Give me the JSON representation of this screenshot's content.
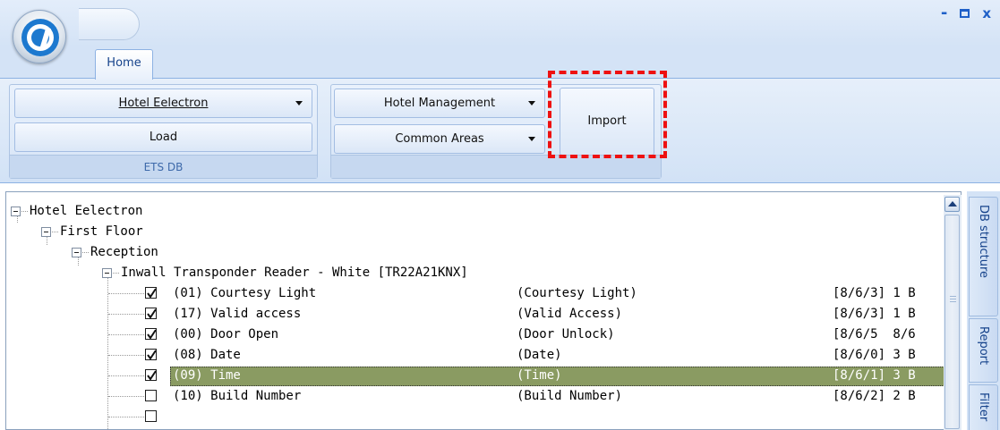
{
  "window": {
    "controls": {
      "minimize": "-",
      "maximize": "□",
      "close": "x"
    }
  },
  "ribbon": {
    "tabs": [
      "Home"
    ],
    "groups": {
      "ets_db": {
        "label": "ETS DB",
        "hotel_select": "Hotel Eelectron",
        "load_label": "Load"
      },
      "hotel": {
        "management_select": "Hotel Management",
        "common_areas_select": "Common Areas",
        "import_label": "Import"
      }
    },
    "highlight_color": "#ee1111"
  },
  "tree": {
    "root": "Hotel Eelectron",
    "floor": "First Floor",
    "room": "Reception",
    "device": "Inwall Transponder Reader - White [TR22A21KNX]",
    "objects": [
      {
        "name": "(01) Courtesy Light",
        "function": "(Courtesy Light)",
        "address": "[8/6/3] 1 B",
        "checked": true
      },
      {
        "name": "(17) Valid access",
        "function": "(Valid Access)",
        "address": "[8/6/3] 1 B",
        "checked": true
      },
      {
        "name": "(00) Door Open",
        "function": "(Door Unlock)",
        "address": "[8/6/5  8/6",
        "checked": true
      },
      {
        "name": "(08) Date",
        "function": "(Date)",
        "address": "[8/6/0] 3 B",
        "checked": true
      },
      {
        "name": "(09) Time",
        "function": "(Time)",
        "address": "[8/6/1] 3 B",
        "checked": true
      },
      {
        "name": "(10) Build Number",
        "function": "(Build Number)",
        "address": "[8/6/2] 2 B",
        "checked": false
      }
    ],
    "selected_row_color": "#8a9b62"
  },
  "side_tabs": {
    "db_structure": "DB structure",
    "report": "Report",
    "filter": "Filter"
  }
}
